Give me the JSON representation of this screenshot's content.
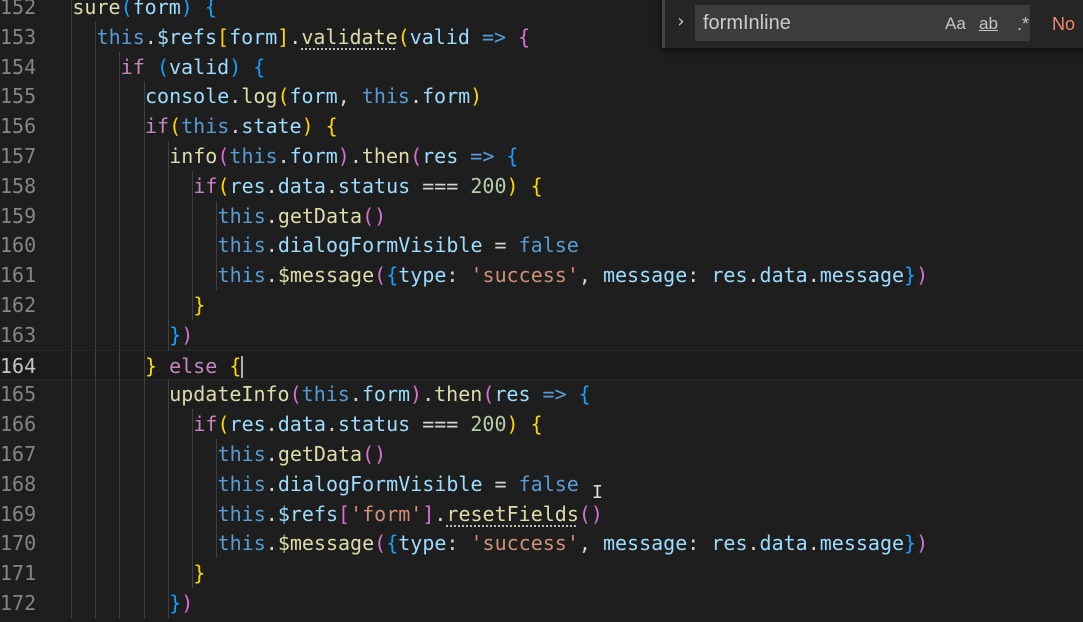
{
  "editor": {
    "lines": [
      {
        "num": "152",
        "active": false,
        "indent": 2,
        "tokens": [
          {
            "t": "sure",
            "c": "f"
          },
          {
            "t": "(",
            "c": "b3"
          },
          {
            "t": "form",
            "c": "v"
          },
          {
            "t": ")",
            "c": "b3"
          },
          {
            "t": " ",
            "c": "p"
          },
          {
            "t": "{",
            "c": "b3"
          }
        ]
      },
      {
        "num": "153",
        "active": false,
        "indent": 3,
        "tokens": [
          {
            "t": "this",
            "c": "k"
          },
          {
            "t": ".",
            "c": "p"
          },
          {
            "t": "$refs",
            "c": "v"
          },
          {
            "t": "[",
            "c": "b1"
          },
          {
            "t": "form",
            "c": "v"
          },
          {
            "t": "]",
            "c": "b1"
          },
          {
            "t": ".",
            "c": "p"
          },
          {
            "t": "validate",
            "c": "f",
            "sq": true
          },
          {
            "t": "(",
            "c": "b1"
          },
          {
            "t": "valid",
            "c": "v"
          },
          {
            "t": " ",
            "c": "p"
          },
          {
            "t": "=>",
            "c": "k"
          },
          {
            "t": " ",
            "c": "p"
          },
          {
            "t": "{",
            "c": "b2"
          }
        ]
      },
      {
        "num": "154",
        "active": false,
        "indent": 4,
        "tokens": [
          {
            "t": "if",
            "c": "c"
          },
          {
            "t": " ",
            "c": "p"
          },
          {
            "t": "(",
            "c": "b3"
          },
          {
            "t": "valid",
            "c": "v"
          },
          {
            "t": ")",
            "c": "b3"
          },
          {
            "t": " ",
            "c": "p"
          },
          {
            "t": "{",
            "c": "b3"
          }
        ]
      },
      {
        "num": "155",
        "active": false,
        "indent": 5,
        "tokens": [
          {
            "t": "console",
            "c": "v"
          },
          {
            "t": ".",
            "c": "p"
          },
          {
            "t": "log",
            "c": "f"
          },
          {
            "t": "(",
            "c": "b1"
          },
          {
            "t": "form",
            "c": "v"
          },
          {
            "t": ", ",
            "c": "p"
          },
          {
            "t": "this",
            "c": "k"
          },
          {
            "t": ".",
            "c": "p"
          },
          {
            "t": "form",
            "c": "v"
          },
          {
            "t": ")",
            "c": "b1"
          }
        ]
      },
      {
        "num": "156",
        "active": false,
        "indent": 5,
        "tokens": [
          {
            "t": "if",
            "c": "c"
          },
          {
            "t": "(",
            "c": "b1"
          },
          {
            "t": "this",
            "c": "k"
          },
          {
            "t": ".",
            "c": "p"
          },
          {
            "t": "state",
            "c": "v"
          },
          {
            "t": ")",
            "c": "b1"
          },
          {
            "t": " ",
            "c": "p"
          },
          {
            "t": "{",
            "c": "b1"
          }
        ]
      },
      {
        "num": "157",
        "active": false,
        "indent": 6,
        "tokens": [
          {
            "t": "info",
            "c": "f"
          },
          {
            "t": "(",
            "c": "b2"
          },
          {
            "t": "this",
            "c": "k"
          },
          {
            "t": ".",
            "c": "p"
          },
          {
            "t": "form",
            "c": "v"
          },
          {
            "t": ")",
            "c": "b2"
          },
          {
            "t": ".",
            "c": "p"
          },
          {
            "t": "then",
            "c": "f"
          },
          {
            "t": "(",
            "c": "b2"
          },
          {
            "t": "res",
            "c": "v"
          },
          {
            "t": " ",
            "c": "p"
          },
          {
            "t": "=>",
            "c": "k"
          },
          {
            "t": " ",
            "c": "p"
          },
          {
            "t": "{",
            "c": "b3"
          }
        ]
      },
      {
        "num": "158",
        "active": false,
        "indent": 7,
        "tokens": [
          {
            "t": "if",
            "c": "c"
          },
          {
            "t": "(",
            "c": "b1"
          },
          {
            "t": "res",
            "c": "v"
          },
          {
            "t": ".",
            "c": "p"
          },
          {
            "t": "data",
            "c": "v"
          },
          {
            "t": ".",
            "c": "p"
          },
          {
            "t": "status",
            "c": "v"
          },
          {
            "t": " === ",
            "c": "p"
          },
          {
            "t": "200",
            "c": "n"
          },
          {
            "t": ")",
            "c": "b1"
          },
          {
            "t": " ",
            "c": "p"
          },
          {
            "t": "{",
            "c": "b1"
          }
        ]
      },
      {
        "num": "159",
        "active": false,
        "indent": 8,
        "tokens": [
          {
            "t": "this",
            "c": "k"
          },
          {
            "t": ".",
            "c": "p"
          },
          {
            "t": "getData",
            "c": "f"
          },
          {
            "t": "()",
            "c": "b2"
          }
        ]
      },
      {
        "num": "160",
        "active": false,
        "indent": 8,
        "tokens": [
          {
            "t": "this",
            "c": "k"
          },
          {
            "t": ".",
            "c": "p"
          },
          {
            "t": "dialogFormVisible",
            "c": "v"
          },
          {
            "t": " = ",
            "c": "p"
          },
          {
            "t": "false",
            "c": "k"
          }
        ]
      },
      {
        "num": "161",
        "active": false,
        "indent": 8,
        "tokens": [
          {
            "t": "this",
            "c": "k"
          },
          {
            "t": ".",
            "c": "p"
          },
          {
            "t": "$message",
            "c": "f"
          },
          {
            "t": "(",
            "c": "b2"
          },
          {
            "t": "{",
            "c": "b3"
          },
          {
            "t": "type",
            "c": "v"
          },
          {
            "t": ": ",
            "c": "p"
          },
          {
            "t": "'success'",
            "c": "s"
          },
          {
            "t": ", ",
            "c": "p"
          },
          {
            "t": "message",
            "c": "v"
          },
          {
            "t": ": ",
            "c": "p"
          },
          {
            "t": "res",
            "c": "v"
          },
          {
            "t": ".",
            "c": "p"
          },
          {
            "t": "data",
            "c": "v"
          },
          {
            "t": ".",
            "c": "p"
          },
          {
            "t": "message",
            "c": "v"
          },
          {
            "t": "}",
            "c": "b3"
          },
          {
            "t": ")",
            "c": "b2"
          }
        ]
      },
      {
        "num": "162",
        "active": false,
        "indent": 7,
        "tokens": [
          {
            "t": "}",
            "c": "b1"
          }
        ]
      },
      {
        "num": "163",
        "active": false,
        "indent": 6,
        "tokens": [
          {
            "t": "}",
            "c": "b3"
          },
          {
            "t": ")",
            "c": "b2"
          }
        ]
      },
      {
        "num": "164",
        "active": true,
        "indent": 5,
        "tokens": [
          {
            "t": "}",
            "c": "b1"
          },
          {
            "t": " ",
            "c": "p"
          },
          {
            "t": "else",
            "c": "c"
          },
          {
            "t": " ",
            "c": "p"
          },
          {
            "t": "{",
            "c": "b1"
          },
          {
            "t": "",
            "c": "cursor"
          }
        ]
      },
      {
        "num": "165",
        "active": false,
        "indent": 6,
        "tokens": [
          {
            "t": "updateInfo",
            "c": "f"
          },
          {
            "t": "(",
            "c": "b2"
          },
          {
            "t": "this",
            "c": "k"
          },
          {
            "t": ".",
            "c": "p"
          },
          {
            "t": "form",
            "c": "v"
          },
          {
            "t": ")",
            "c": "b2"
          },
          {
            "t": ".",
            "c": "p"
          },
          {
            "t": "then",
            "c": "f"
          },
          {
            "t": "(",
            "c": "b2"
          },
          {
            "t": "res",
            "c": "v"
          },
          {
            "t": " ",
            "c": "p"
          },
          {
            "t": "=>",
            "c": "k"
          },
          {
            "t": " ",
            "c": "p"
          },
          {
            "t": "{",
            "c": "b3"
          }
        ]
      },
      {
        "num": "166",
        "active": false,
        "indent": 7,
        "tokens": [
          {
            "t": "if",
            "c": "c"
          },
          {
            "t": "(",
            "c": "b1"
          },
          {
            "t": "res",
            "c": "v"
          },
          {
            "t": ".",
            "c": "p"
          },
          {
            "t": "data",
            "c": "v"
          },
          {
            "t": ".",
            "c": "p"
          },
          {
            "t": "status",
            "c": "v"
          },
          {
            "t": " === ",
            "c": "p"
          },
          {
            "t": "200",
            "c": "n"
          },
          {
            "t": ")",
            "c": "b1"
          },
          {
            "t": " ",
            "c": "p"
          },
          {
            "t": "{",
            "c": "b1"
          }
        ]
      },
      {
        "num": "167",
        "active": false,
        "indent": 8,
        "tokens": [
          {
            "t": "this",
            "c": "k"
          },
          {
            "t": ".",
            "c": "p"
          },
          {
            "t": "getData",
            "c": "f"
          },
          {
            "t": "()",
            "c": "b2"
          }
        ]
      },
      {
        "num": "168",
        "active": false,
        "indent": 8,
        "tokens": [
          {
            "t": "this",
            "c": "k"
          },
          {
            "t": ".",
            "c": "p"
          },
          {
            "t": "dialogFormVisible",
            "c": "v"
          },
          {
            "t": " = ",
            "c": "p"
          },
          {
            "t": "false",
            "c": "k"
          }
        ]
      },
      {
        "num": "169",
        "active": false,
        "indent": 8,
        "tokens": [
          {
            "t": "this",
            "c": "k"
          },
          {
            "t": ".",
            "c": "p"
          },
          {
            "t": "$refs",
            "c": "v"
          },
          {
            "t": "[",
            "c": "b2"
          },
          {
            "t": "'form'",
            "c": "s"
          },
          {
            "t": "]",
            "c": "b2"
          },
          {
            "t": ".",
            "c": "p"
          },
          {
            "t": "resetFields",
            "c": "f",
            "sq": true
          },
          {
            "t": "()",
            "c": "b2"
          }
        ]
      },
      {
        "num": "170",
        "active": false,
        "indent": 8,
        "tokens": [
          {
            "t": "this",
            "c": "k"
          },
          {
            "t": ".",
            "c": "p"
          },
          {
            "t": "$message",
            "c": "f"
          },
          {
            "t": "(",
            "c": "b2"
          },
          {
            "t": "{",
            "c": "b3"
          },
          {
            "t": "type",
            "c": "v"
          },
          {
            "t": ": ",
            "c": "p"
          },
          {
            "t": "'success'",
            "c": "s"
          },
          {
            "t": ", ",
            "c": "p"
          },
          {
            "t": "message",
            "c": "v"
          },
          {
            "t": ": ",
            "c": "p"
          },
          {
            "t": "res",
            "c": "v"
          },
          {
            "t": ".",
            "c": "p"
          },
          {
            "t": "data",
            "c": "v"
          },
          {
            "t": ".",
            "c": "p"
          },
          {
            "t": "message",
            "c": "v"
          },
          {
            "t": "}",
            "c": "b3"
          },
          {
            "t": ")",
            "c": "b2"
          }
        ]
      },
      {
        "num": "171",
        "active": false,
        "indent": 7,
        "tokens": [
          {
            "t": "}",
            "c": "b1"
          }
        ]
      },
      {
        "num": "172",
        "active": false,
        "indent": 6,
        "tokens": [
          {
            "t": "}",
            "c": "b3"
          },
          {
            "t": ")",
            "c": "b2"
          }
        ]
      }
    ]
  },
  "find_widget": {
    "toggle_icon": "chevron-right-icon",
    "toggle_glyph": "›",
    "query": "formInline",
    "match_case_label": "Aa",
    "whole_word_label": "ab",
    "regex_label": ".*",
    "result_text": "No"
  },
  "colors": {
    "background": "#1e1e1e",
    "keyword": "#569cd6",
    "control": "#c586c0",
    "function": "#dcdcaa",
    "variable": "#9cdcfe",
    "string": "#ce9178",
    "number": "#b5cea8",
    "bracket_1": "#ffd700",
    "bracket_2": "#da70d6",
    "bracket_3": "#179fff",
    "no_results": "#f48771"
  }
}
